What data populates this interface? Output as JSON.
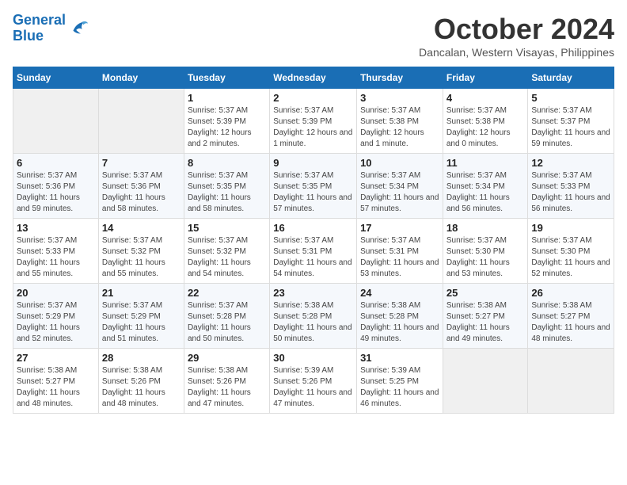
{
  "header": {
    "logo_line1": "General",
    "logo_line2": "Blue",
    "month_title": "October 2024",
    "location": "Dancalan, Western Visayas, Philippines"
  },
  "days_of_week": [
    "Sunday",
    "Monday",
    "Tuesday",
    "Wednesday",
    "Thursday",
    "Friday",
    "Saturday"
  ],
  "weeks": [
    [
      {
        "day": "",
        "info": ""
      },
      {
        "day": "",
        "info": ""
      },
      {
        "day": "1",
        "info": "Sunrise: 5:37 AM\nSunset: 5:39 PM\nDaylight: 12 hours and 2 minutes."
      },
      {
        "day": "2",
        "info": "Sunrise: 5:37 AM\nSunset: 5:39 PM\nDaylight: 12 hours and 1 minute."
      },
      {
        "day": "3",
        "info": "Sunrise: 5:37 AM\nSunset: 5:38 PM\nDaylight: 12 hours and 1 minute."
      },
      {
        "day": "4",
        "info": "Sunrise: 5:37 AM\nSunset: 5:38 PM\nDaylight: 12 hours and 0 minutes."
      },
      {
        "day": "5",
        "info": "Sunrise: 5:37 AM\nSunset: 5:37 PM\nDaylight: 11 hours and 59 minutes."
      }
    ],
    [
      {
        "day": "6",
        "info": "Sunrise: 5:37 AM\nSunset: 5:36 PM\nDaylight: 11 hours and 59 minutes."
      },
      {
        "day": "7",
        "info": "Sunrise: 5:37 AM\nSunset: 5:36 PM\nDaylight: 11 hours and 58 minutes."
      },
      {
        "day": "8",
        "info": "Sunrise: 5:37 AM\nSunset: 5:35 PM\nDaylight: 11 hours and 58 minutes."
      },
      {
        "day": "9",
        "info": "Sunrise: 5:37 AM\nSunset: 5:35 PM\nDaylight: 11 hours and 57 minutes."
      },
      {
        "day": "10",
        "info": "Sunrise: 5:37 AM\nSunset: 5:34 PM\nDaylight: 11 hours and 57 minutes."
      },
      {
        "day": "11",
        "info": "Sunrise: 5:37 AM\nSunset: 5:34 PM\nDaylight: 11 hours and 56 minutes."
      },
      {
        "day": "12",
        "info": "Sunrise: 5:37 AM\nSunset: 5:33 PM\nDaylight: 11 hours and 56 minutes."
      }
    ],
    [
      {
        "day": "13",
        "info": "Sunrise: 5:37 AM\nSunset: 5:33 PM\nDaylight: 11 hours and 55 minutes."
      },
      {
        "day": "14",
        "info": "Sunrise: 5:37 AM\nSunset: 5:32 PM\nDaylight: 11 hours and 55 minutes."
      },
      {
        "day": "15",
        "info": "Sunrise: 5:37 AM\nSunset: 5:32 PM\nDaylight: 11 hours and 54 minutes."
      },
      {
        "day": "16",
        "info": "Sunrise: 5:37 AM\nSunset: 5:31 PM\nDaylight: 11 hours and 54 minutes."
      },
      {
        "day": "17",
        "info": "Sunrise: 5:37 AM\nSunset: 5:31 PM\nDaylight: 11 hours and 53 minutes."
      },
      {
        "day": "18",
        "info": "Sunrise: 5:37 AM\nSunset: 5:30 PM\nDaylight: 11 hours and 53 minutes."
      },
      {
        "day": "19",
        "info": "Sunrise: 5:37 AM\nSunset: 5:30 PM\nDaylight: 11 hours and 52 minutes."
      }
    ],
    [
      {
        "day": "20",
        "info": "Sunrise: 5:37 AM\nSunset: 5:29 PM\nDaylight: 11 hours and 52 minutes."
      },
      {
        "day": "21",
        "info": "Sunrise: 5:37 AM\nSunset: 5:29 PM\nDaylight: 11 hours and 51 minutes."
      },
      {
        "day": "22",
        "info": "Sunrise: 5:37 AM\nSunset: 5:28 PM\nDaylight: 11 hours and 50 minutes."
      },
      {
        "day": "23",
        "info": "Sunrise: 5:38 AM\nSunset: 5:28 PM\nDaylight: 11 hours and 50 minutes."
      },
      {
        "day": "24",
        "info": "Sunrise: 5:38 AM\nSunset: 5:28 PM\nDaylight: 11 hours and 49 minutes."
      },
      {
        "day": "25",
        "info": "Sunrise: 5:38 AM\nSunset: 5:27 PM\nDaylight: 11 hours and 49 minutes."
      },
      {
        "day": "26",
        "info": "Sunrise: 5:38 AM\nSunset: 5:27 PM\nDaylight: 11 hours and 48 minutes."
      }
    ],
    [
      {
        "day": "27",
        "info": "Sunrise: 5:38 AM\nSunset: 5:27 PM\nDaylight: 11 hours and 48 minutes."
      },
      {
        "day": "28",
        "info": "Sunrise: 5:38 AM\nSunset: 5:26 PM\nDaylight: 11 hours and 48 minutes."
      },
      {
        "day": "29",
        "info": "Sunrise: 5:38 AM\nSunset: 5:26 PM\nDaylight: 11 hours and 47 minutes."
      },
      {
        "day": "30",
        "info": "Sunrise: 5:39 AM\nSunset: 5:26 PM\nDaylight: 11 hours and 47 minutes."
      },
      {
        "day": "31",
        "info": "Sunrise: 5:39 AM\nSunset: 5:25 PM\nDaylight: 11 hours and 46 minutes."
      },
      {
        "day": "",
        "info": ""
      },
      {
        "day": "",
        "info": ""
      }
    ]
  ]
}
